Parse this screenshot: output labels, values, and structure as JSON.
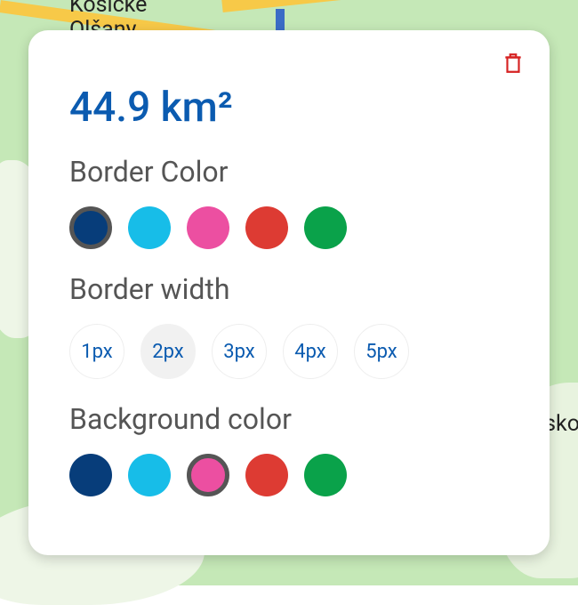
{
  "map": {
    "town_label": "Košické\nOlšany",
    "side_label": "sko"
  },
  "card": {
    "measurement": "44.9 km²",
    "delete_label": "Delete",
    "sections": {
      "border_color": {
        "title": "Border Color",
        "options": [
          {
            "color": "#073d7a",
            "selected": true
          },
          {
            "color": "#17bde8",
            "selected": false
          },
          {
            "color": "#ec4fa1",
            "selected": false
          },
          {
            "color": "#dd3b33",
            "selected": false
          },
          {
            "color": "#0aa24a",
            "selected": false
          }
        ]
      },
      "border_width": {
        "title": "Border width",
        "options": [
          {
            "label": "1px",
            "selected": false
          },
          {
            "label": "2px",
            "selected": true
          },
          {
            "label": "3px",
            "selected": false
          },
          {
            "label": "4px",
            "selected": false
          },
          {
            "label": "5px",
            "selected": false
          }
        ]
      },
      "background_color": {
        "title": "Background color",
        "options": [
          {
            "color": "#073d7a",
            "selected": false
          },
          {
            "color": "#17bde8",
            "selected": false
          },
          {
            "color": "#ec4fa1",
            "selected": true
          },
          {
            "color": "#dd3b33",
            "selected": false
          },
          {
            "color": "#0aa24a",
            "selected": false
          }
        ]
      }
    }
  }
}
